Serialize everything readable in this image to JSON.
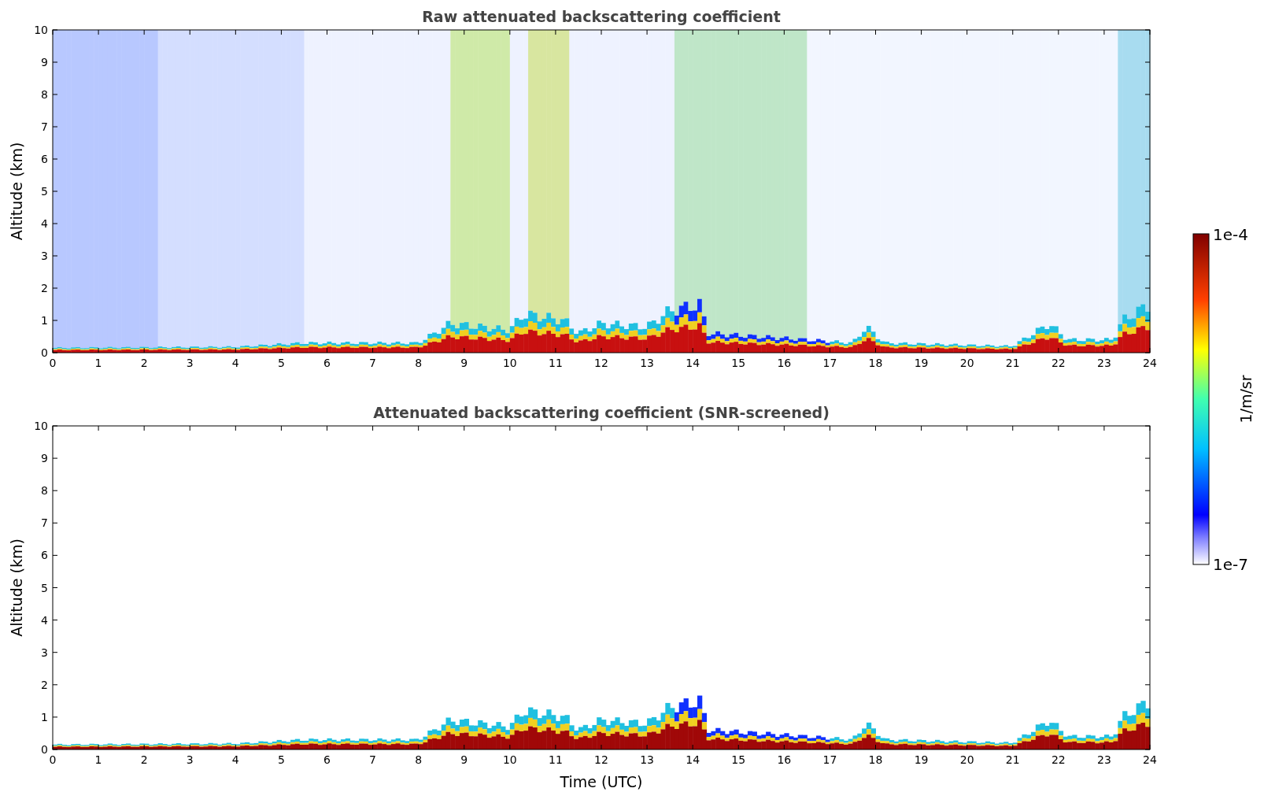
{
  "plots": [
    {
      "title": "Raw attenuated backscattering coefficient",
      "ylabel": "Altitude (km)",
      "kind": "raw",
      "xticks": [
        "0",
        "1",
        "2",
        "3",
        "4",
        "5",
        "6",
        "7",
        "8",
        "9",
        "10",
        "11",
        "12",
        "13",
        "14",
        "15",
        "16",
        "17",
        "18",
        "19",
        "20",
        "21",
        "22",
        "23",
        "24"
      ],
      "yticks": [
        "10",
        "9",
        "8",
        "7",
        "6",
        "5",
        "4",
        "3",
        "2",
        "1",
        "0"
      ]
    },
    {
      "title": "Attenuated backscattering coefficient (SNR-screened)",
      "ylabel": "Altitude (km)",
      "kind": "screened",
      "xticks": [
        "0",
        "1",
        "2",
        "3",
        "4",
        "5",
        "6",
        "7",
        "8",
        "9",
        "10",
        "11",
        "12",
        "13",
        "14",
        "15",
        "16",
        "17",
        "18",
        "19",
        "20",
        "21",
        "22",
        "23",
        "24"
      ],
      "yticks": [
        "10",
        "9",
        "8",
        "7",
        "6",
        "5",
        "4",
        "3",
        "2",
        "1",
        "0"
      ],
      "xlabel": "Time (UTC)"
    }
  ],
  "colorbar": {
    "max": "1e-4",
    "min": "1e-7",
    "label": "1/m/sr"
  }
}
